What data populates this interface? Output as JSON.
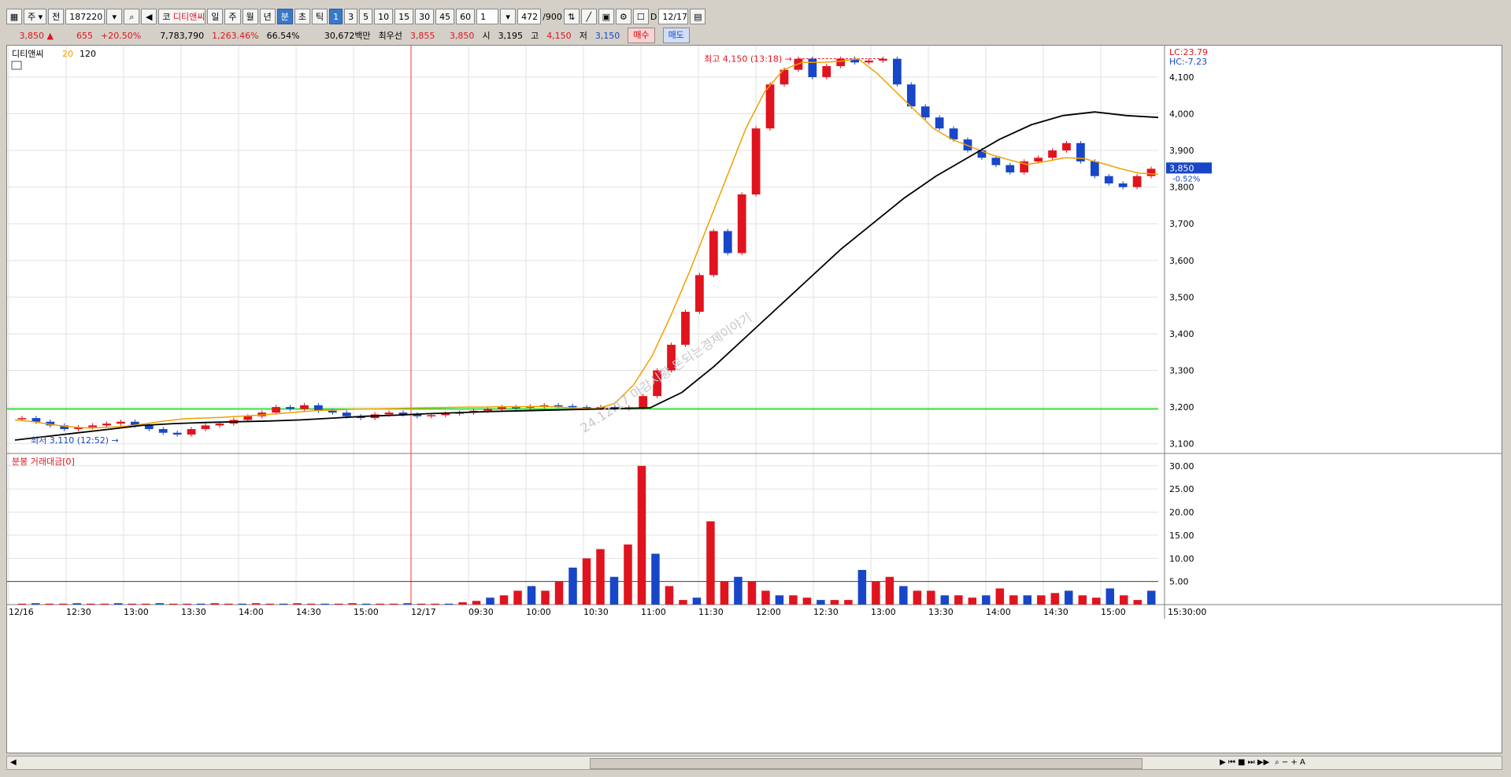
{
  "toolbar": {
    "market_label": "주",
    "prev_label": "전",
    "code": "187220",
    "stock_badge": "코",
    "stock_name": "디티앤씨",
    "periods": [
      "일",
      "주",
      "월",
      "년",
      "분",
      "초",
      "틱"
    ],
    "intervals": [
      "1",
      "3",
      "5",
      "10",
      "15",
      "30",
      "45",
      "60"
    ],
    "multiplier": "1",
    "count": "472",
    "count_max": "/900",
    "date_checkbox_label": "D",
    "date": "12/17"
  },
  "quote": {
    "price": "3,850",
    "change_arrow": "▲",
    "change": "655",
    "change_pct": "+20.50%",
    "volume": "7,783,790",
    "volume_ratio": "1,263.46%",
    "turnover": "66.54%",
    "amount": "30,672백만",
    "best_label": "최우선",
    "best_ask": "3,855",
    "best_bid": "3,850",
    "open_label": "시",
    "open": "3,195",
    "high_label": "고",
    "high": "4,150",
    "low_label": "저",
    "low": "3,150",
    "buy_button": "매수",
    "sell_button": "매도"
  },
  "colors": {
    "up": "#e0141e",
    "down": "#1846c8",
    "ma20": "#f0a000",
    "ma120": "#000000",
    "hline": "#00dd00"
  },
  "chart_data": [
    {
      "type": "candlestick",
      "title": "디티앤씨",
      "legend": [
        "20",
        "120"
      ],
      "y_ticks": [
        "4,100",
        "4,000",
        "3,900",
        "3,800",
        "3,700",
        "3,600",
        "3,500",
        "3,400",
        "3,300",
        "3,200",
        "3,100"
      ],
      "ylim": [
        3080,
        4160
      ],
      "x_ticks": [
        "12/16",
        "12:30",
        "13:00",
        "13:30",
        "14:00",
        "14:30",
        "15:00",
        "12/17",
        "09:30",
        "10:00",
        "10:30",
        "11:00",
        "11:30",
        "12:00",
        "12:30",
        "13:00",
        "13:30",
        "14:00",
        "14:30",
        "15:00",
        "15:30:00"
      ],
      "corner_labels": {
        "lc": "LC:23.79",
        "hc": "HC:-7.23"
      },
      "current_price": "3,850",
      "current_change": "-0.52%",
      "high_annotation": "최고 4,150 (13:18)",
      "low_annotation": "최저 3,110 (12:52)",
      "horizontal_line": 3195,
      "watermark": "24.12.17 마감시황 돈되는경제이야기",
      "closes": [
        3170,
        3160,
        3150,
        3140,
        3145,
        3150,
        3155,
        3160,
        3150,
        3140,
        3130,
        3125,
        3140,
        3150,
        3155,
        3165,
        3175,
        3185,
        3200,
        3195,
        3205,
        3190,
        3185,
        3175,
        3170,
        3180,
        3185,
        3180,
        3175,
        3178,
        3182,
        3185,
        3190,
        3195,
        3200,
        3198,
        3202,
        3205,
        3203,
        3200,
        3198,
        3200,
        3197,
        3199,
        3230,
        3300,
        3370,
        3460,
        3560,
        3680,
        3620,
        3780,
        3960,
        4080,
        4120,
        4150,
        4100,
        4130,
        4150,
        4140,
        4145,
        4150,
        4080,
        4020,
        3990,
        3960,
        3930,
        3900,
        3880,
        3860,
        3840,
        3870,
        3880,
        3900,
        3920,
        3870,
        3830,
        3810,
        3800,
        3830,
        3850
      ],
      "ma20": [
        3165,
        3160,
        3152,
        3146,
        3143,
        3145,
        3148,
        3155,
        3162,
        3168,
        3170,
        3172,
        3175,
        3178,
        3182,
        3186,
        3190,
        3192,
        3194,
        3195,
        3196,
        3197,
        3198,
        3199,
        3200,
        3200,
        3201,
        3201,
        3202,
        3200,
        3197,
        3195,
        3210,
        3260,
        3340,
        3450,
        3570,
        3700,
        3830,
        3960,
        4060,
        4120,
        4140,
        4140,
        4143,
        4150,
        4110,
        4060,
        4010,
        3960,
        3930,
        3910,
        3890,
        3875,
        3862,
        3870,
        3880,
        3878,
        3865,
        3850,
        3838,
        3835
      ],
      "ma120": [
        3110,
        3120,
        3130,
        3140,
        3150,
        3155,
        3158,
        3160,
        3162,
        3165,
        3170,
        3175,
        3178,
        3182,
        3185,
        3188,
        3190,
        3192,
        3194,
        3196,
        3198,
        3240,
        3310,
        3390,
        3470,
        3550,
        3630,
        3700,
        3770,
        3830,
        3880,
        3930,
        3970,
        3995,
        4005,
        3995,
        3990
      ]
    },
    {
      "type": "bar",
      "title": "분봉 거래대금[0]",
      "y_ticks": [
        "30.00",
        "25.00",
        "20.00",
        "15.00",
        "10.00",
        "5.00"
      ],
      "ylim": [
        0,
        32
      ],
      "reference_line": 5,
      "values": [
        0.2,
        0.3,
        0.2,
        0.2,
        0.3,
        0.2,
        0.2,
        0.3,
        0.2,
        0.2,
        0.3,
        0.2,
        0.2,
        0.2,
        0.3,
        0.2,
        0.2,
        0.3,
        0.2,
        0.2,
        0.3,
        0.2,
        0.2,
        0.2,
        0.3,
        0.2,
        0.2,
        0.2,
        0.3,
        0.2,
        0.2,
        0.2,
        0.5,
        0.8,
        1.5,
        2.0,
        3.0,
        4.0,
        3.0,
        5.0,
        8.0,
        10.0,
        12.0,
        6.0,
        13.0,
        30.0,
        11.0,
        4.0,
        1.0,
        1.5,
        18.0,
        5.0,
        6.0,
        5.0,
        3.0,
        2.0,
        2.0,
        1.5,
        1.0,
        1.0,
        1.0,
        7.5,
        5.0,
        6.0,
        4.0,
        3.0,
        3.0,
        2.0,
        2.0,
        1.5,
        2.0,
        3.5,
        2.0,
        2.0,
        2.0,
        2.5,
        3.0,
        2.0,
        1.5,
        3.5,
        2.0,
        1.0,
        3.0
      ]
    }
  ]
}
